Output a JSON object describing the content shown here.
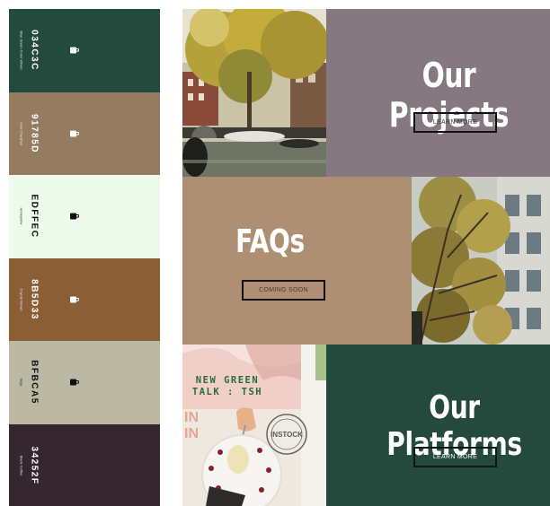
{
  "palette": [
    {
      "hex": "034C3C",
      "name": "Blue Green Color Wheel",
      "bg": "#234a3c",
      "fg": "#ffffff"
    },
    {
      "hex": "91785D",
      "name": "Liver Chestnut",
      "bg": "#957b60",
      "fg": "#ffffff"
    },
    {
      "hex": "EDFFEC",
      "name": "Honeydew",
      "bg": "#edfbea",
      "fg": "#111111"
    },
    {
      "hex": "8B5D33",
      "name": "Coyote Brown",
      "bg": "#8b5e36",
      "fg": "#ffffff"
    },
    {
      "hex": "BFBCA5",
      "name": "Sage",
      "bg": "#bbb9a4",
      "fg": "#111111"
    },
    {
      "hex": "34252F",
      "name": "Black Coffee",
      "bg": "#35262f",
      "fg": "#ffffff"
    }
  ],
  "projects": {
    "title": "Our Projects",
    "button": "LEARN MORE"
  },
  "faqs": {
    "title": "FAQs",
    "button": "COMING SOON"
  },
  "platforms": {
    "title": "Our Platforms",
    "button": "LEARN MORE"
  },
  "promo": {
    "line1": "NEW GREEN",
    "line2": "TALK : TSH",
    "stamp": "INSTOCK"
  }
}
